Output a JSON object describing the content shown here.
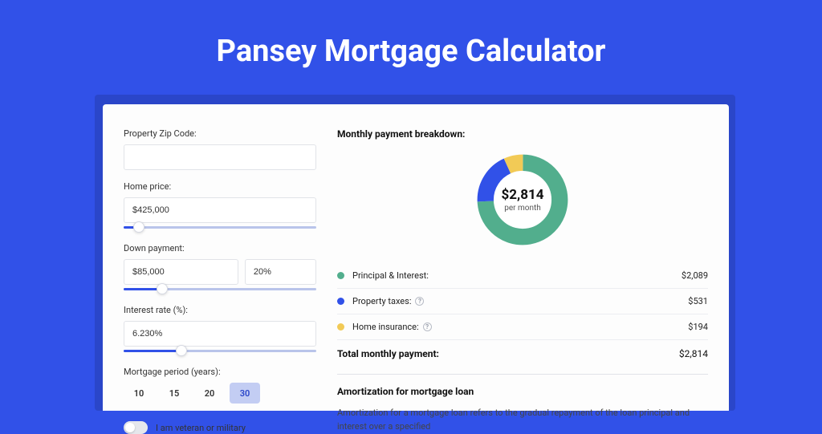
{
  "title": "Pansey Mortgage Calculator",
  "form": {
    "zip_label": "Property Zip Code:",
    "zip_value": "",
    "home_price_label": "Home price:",
    "home_price_value": "$425,000",
    "home_price_slider_pct": 8,
    "down_payment_label": "Down payment:",
    "down_payment_amount": "$85,000",
    "down_payment_pct": "20%",
    "down_payment_slider_pct": 20,
    "interest_label": "Interest rate (%):",
    "interest_value": "6.230%",
    "interest_slider_pct": 30,
    "period_label": "Mortgage period (years):",
    "periods": [
      "10",
      "15",
      "20",
      "30"
    ],
    "period_active_index": 3,
    "veteran_label": "I am veteran or military"
  },
  "breakdown": {
    "title": "Monthly payment breakdown:",
    "total_big": "$2,814",
    "total_sub": "per month",
    "items": [
      {
        "label": "Principal & Interest:",
        "amount": "$2,089",
        "color": "#52ae8d",
        "help": false
      },
      {
        "label": "Property taxes:",
        "amount": "$531",
        "color": "#3151e8",
        "help": true
      },
      {
        "label": "Home insurance:",
        "amount": "$194",
        "color": "#f2ca56",
        "help": true
      }
    ],
    "total_label": "Total monthly payment:",
    "total_amount": "$2,814"
  },
  "amort": {
    "title": "Amortization for mortgage loan",
    "text": "Amortization for a mortgage loan refers to the gradual repayment of the loan principal and interest over a specified"
  },
  "chart_data": {
    "type": "pie",
    "title": "Monthly payment breakdown",
    "series": [
      {
        "name": "Principal & Interest",
        "value": 2089,
        "color": "#52ae8d"
      },
      {
        "name": "Property taxes",
        "value": 531,
        "color": "#3151e8"
      },
      {
        "name": "Home insurance",
        "value": 194,
        "color": "#f2ca56"
      }
    ],
    "total": 2814,
    "center_label": "$2,814 per month"
  }
}
